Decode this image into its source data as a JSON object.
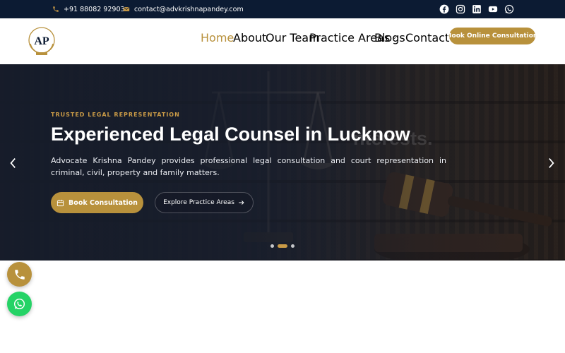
{
  "topbar": {
    "phone": "+91 88082 92903",
    "email": "contact@advkrishnapandey.com",
    "social": [
      "facebook-icon",
      "instagram-icon",
      "linkedin-icon",
      "youtube-icon",
      "whatsapp-icon"
    ]
  },
  "logo": {
    "text": "AP"
  },
  "nav": {
    "items": [
      {
        "label": "Home",
        "active": true
      },
      {
        "label": "About"
      },
      {
        "label": "Our Team"
      },
      {
        "label": "Practice Areas",
        "dropdown": true
      },
      {
        "label": "Blogs"
      },
      {
        "label": "Contact",
        "dropdown": true
      }
    ],
    "cta_label": "Book Online Consultation"
  },
  "hero": {
    "eyebrow": "TRUSTED LEGAL REPRESENTATION",
    "title": "Experienced Legal Counsel in Lucknow",
    "ghost_text": "nterests.",
    "description": "Advocate Krishna Pandey provides professional legal consultation and court representation in criminal, civil, property and family matters.",
    "primary_cta": "Book Consultation",
    "secondary_cta": "Explore Practice Areas",
    "slide_count": 3,
    "active_slide": 2
  },
  "colors": {
    "accent": "#b8913c",
    "topbar": "#0c1b33",
    "whatsapp": "#25d366"
  },
  "floating": [
    "phone-icon",
    "whatsapp-icon"
  ]
}
